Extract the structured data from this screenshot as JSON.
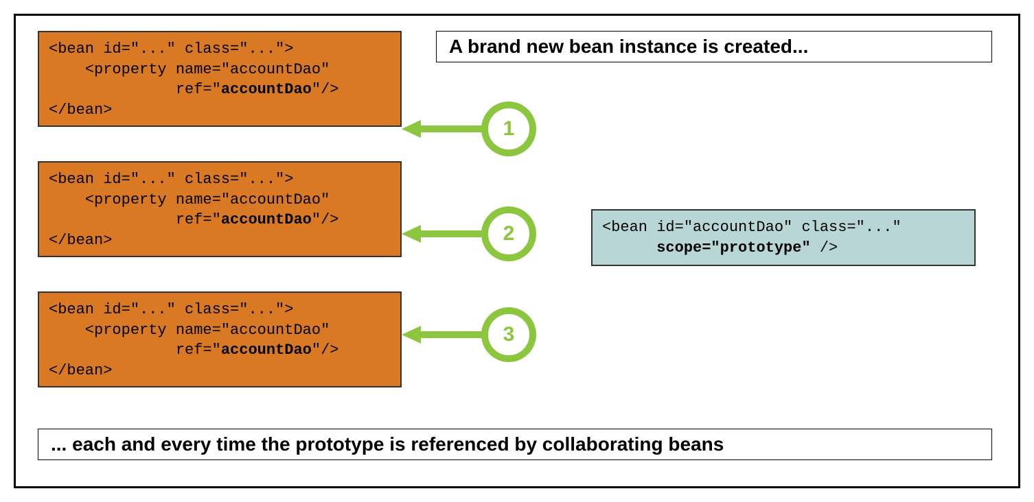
{
  "title_top": "A brand new bean instance is created...",
  "title_bottom": "... each and every time the prototype is referenced by collaborating beans",
  "bean_line1": "<bean id=\"...\" class=\"...\">",
  "bean_line2_a": "    <property name=\"accountDao\"",
  "bean_line3_a": "              ref=\"",
  "bean_line3_b": "accountDao",
  "bean_line3_c": "\"/>",
  "bean_line4": "</bean>",
  "proto_line1": "<bean id=\"accountDao\" class=\"...\"",
  "proto_line2_a": "      ",
  "proto_line2_b": "scope=\"prototype\"",
  "proto_line2_c": " />",
  "num1": "1",
  "num2": "2",
  "num3": "3"
}
